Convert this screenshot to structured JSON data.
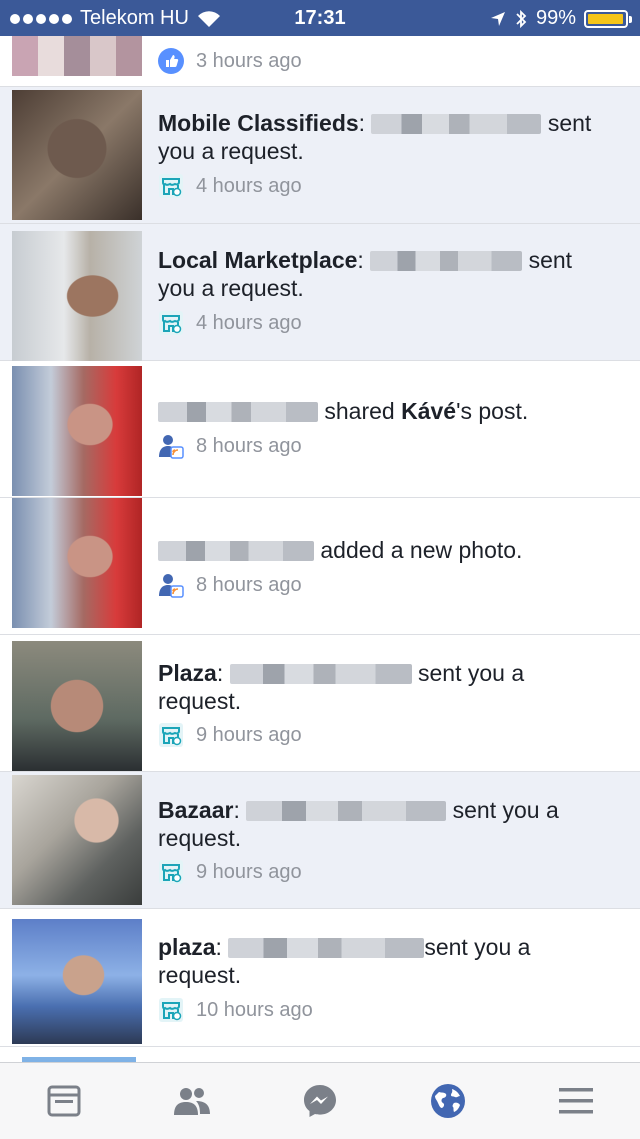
{
  "status_bar": {
    "carrier": "Telekom HU",
    "time": "17:31",
    "battery": "99%",
    "battery_level": 0.99
  },
  "notifications": [
    {
      "time": "3 hours ago",
      "icon": "like-icon",
      "unread": false
    },
    {
      "prefix": "Mobile Classifieds",
      "action": "sent",
      "action2": "you a request.",
      "time": "4 hours ago",
      "icon": "marketplace-icon",
      "unread": true
    },
    {
      "prefix": "Local Marketplace",
      "action": "sent",
      "action2": "you a request.",
      "time": "4 hours ago",
      "icon": "marketplace-icon",
      "unread": true
    },
    {
      "action": "shared",
      "bold": "Kávé",
      "suffix": "'s post.",
      "time": "8 hours ago",
      "icon": "share-icon",
      "unread": false
    },
    {
      "action": "added a new photo.",
      "time": "8 hours ago",
      "icon": "share-icon",
      "unread": false
    },
    {
      "prefix": "Plaza",
      "action": "sent you a",
      "action2": "request.",
      "time": "9 hours ago",
      "icon": "marketplace-icon",
      "unread": false
    },
    {
      "prefix": "Bazaar",
      "action": "sent you a",
      "action2": "request.",
      "time": "9 hours ago",
      "icon": "marketplace-icon",
      "unread": true
    },
    {
      "prefix": "plaza",
      "action": "sent you a",
      "action2": "request.",
      "time": "10 hours ago",
      "icon": "marketplace-icon",
      "unread": false
    }
  ],
  "tab_bar": {
    "tabs": [
      {
        "name": "news-feed-icon",
        "active": false
      },
      {
        "name": "friends-icon",
        "active": false
      },
      {
        "name": "messenger-icon",
        "active": false
      },
      {
        "name": "globe-icon",
        "active": true
      },
      {
        "name": "menu-icon",
        "active": false
      }
    ]
  },
  "colors": {
    "brand_blue": "#3b5998",
    "active_tab": "#4267b2",
    "unread_bg": "#edf0f7",
    "battery_yellow": "#f5c518",
    "marketplace_teal": "#1ba5b8"
  }
}
